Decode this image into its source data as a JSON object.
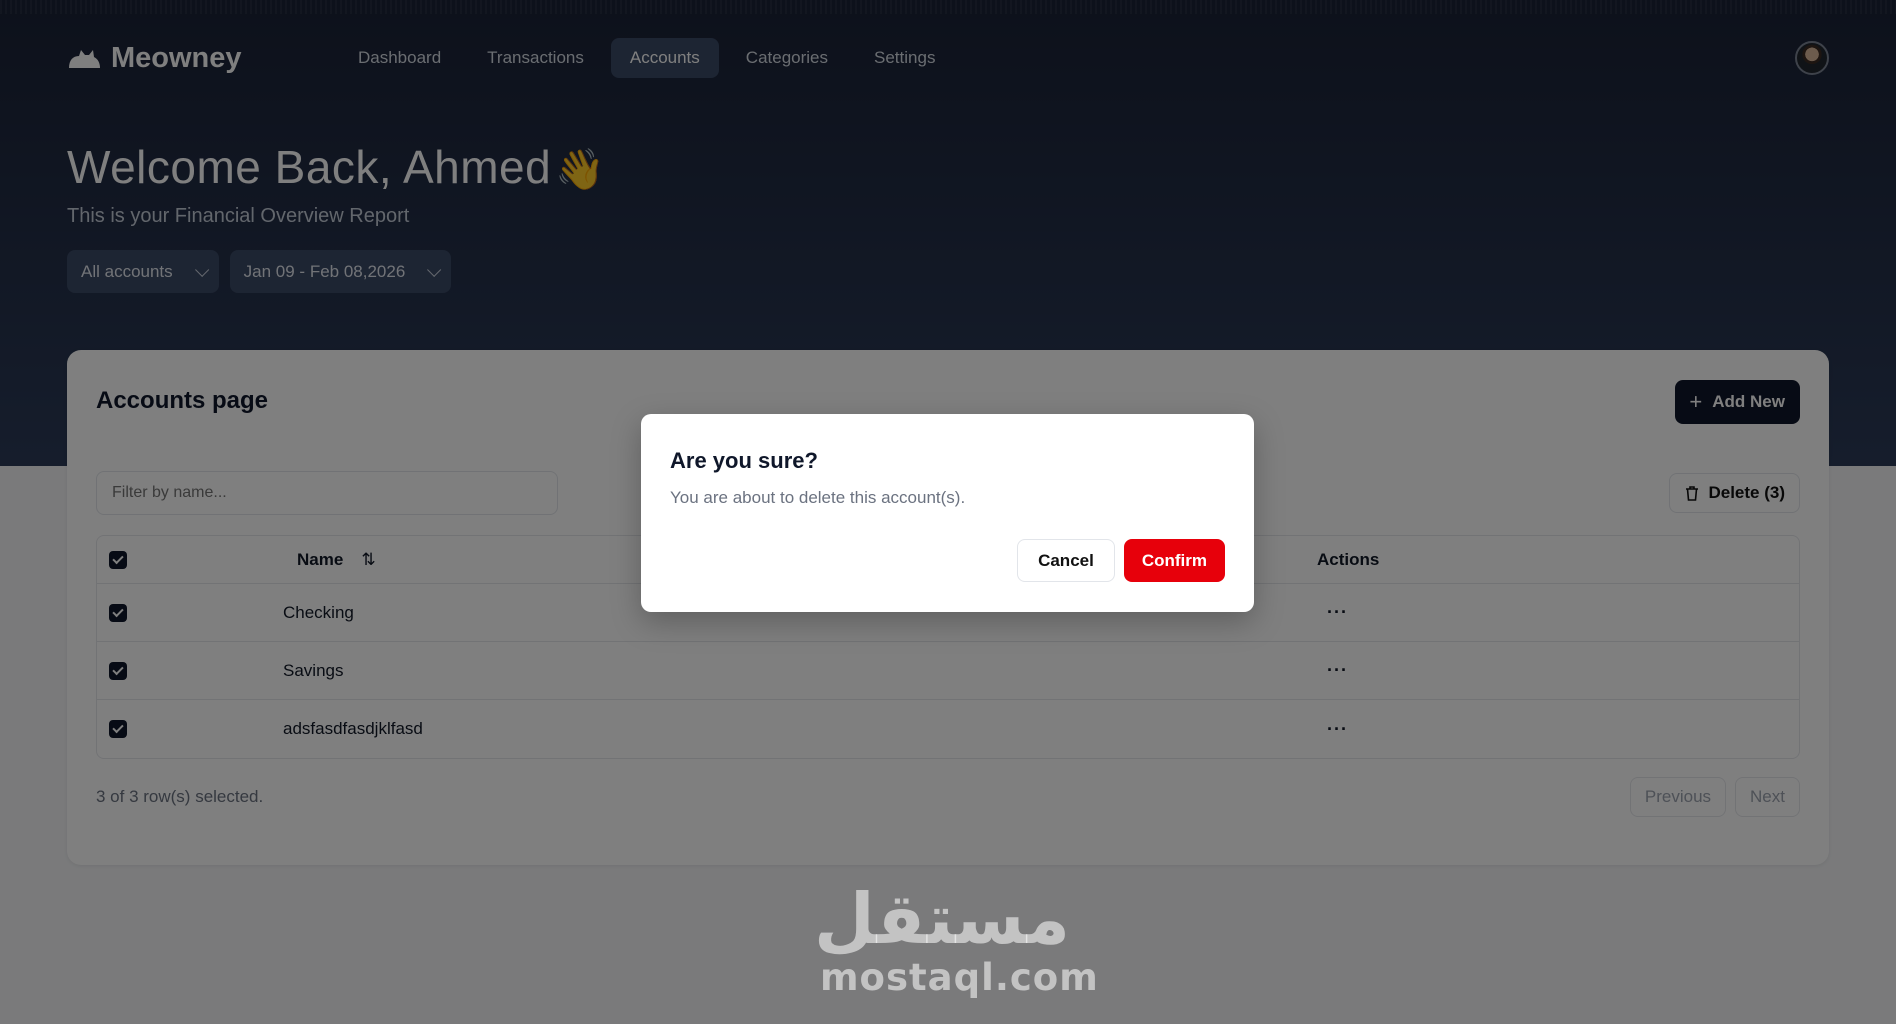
{
  "app": {
    "name": "Meowney"
  },
  "nav": {
    "links": [
      {
        "label": "Dashboard"
      },
      {
        "label": "Transactions"
      },
      {
        "label": "Accounts",
        "active": true
      },
      {
        "label": "Categories"
      },
      {
        "label": "Settings"
      }
    ]
  },
  "hero": {
    "welcome": "Welcome Back, Ahmed",
    "wave_emoji": "👋",
    "subtitle": "This is your Financial Overview Report",
    "account_filter": "All accounts",
    "date_range": "Jan 09 - Feb 08,2026"
  },
  "card": {
    "title": "Accounts page",
    "add_button": "Add New",
    "filter_placeholder": "Filter by name...",
    "delete_button": "Delete (3)",
    "columns": {
      "name": "Name",
      "actions": "Actions"
    },
    "rows": [
      {
        "name": "Checking",
        "selected": true
      },
      {
        "name": "Savings",
        "selected": true
      },
      {
        "name": "adsfasdfasdjklfasd",
        "selected": true
      }
    ],
    "actions_glyph": "···",
    "selection_info": "3 of 3 row(s) selected.",
    "pager": {
      "previous": "Previous",
      "next": "Next"
    }
  },
  "dialog": {
    "title": "Are you sure?",
    "description": "You are about to delete this account(s).",
    "cancel": "Cancel",
    "confirm": "Confirm"
  },
  "watermark": {
    "arabic": "مستقل",
    "latin": "mostaql.com"
  },
  "colors": {
    "hero_top": "#1a2236",
    "primary_dark": "#0f172a",
    "danger": "#e7000b"
  }
}
